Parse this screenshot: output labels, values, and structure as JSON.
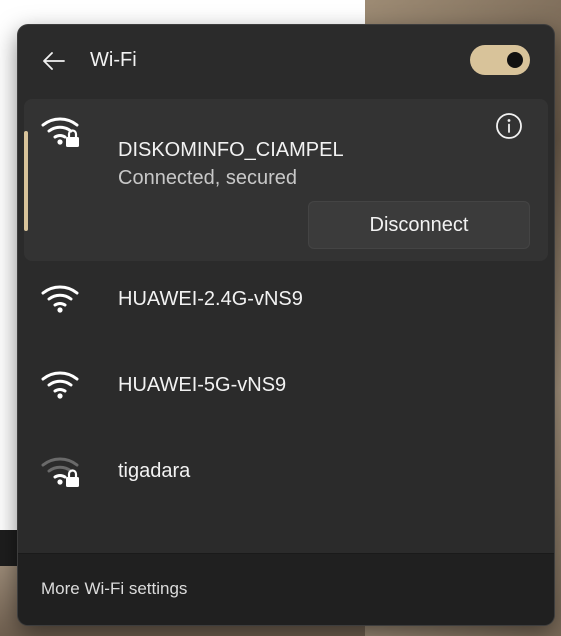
{
  "header": {
    "title": "Wi-Fi",
    "back_icon": "back-arrow-icon",
    "wifi_toggle_on": true,
    "accent_color": "#d8c39a"
  },
  "networks": [
    {
      "name": "DISKOMINFO_CIAMPEL",
      "status": "Connected, secured",
      "secured": true,
      "signal": "full",
      "icon": "wifi-secured-icon"
    },
    {
      "name": "HUAWEI-2.4G-vNS9",
      "secured": false,
      "signal": "full",
      "icon": "wifi-icon"
    },
    {
      "name": "HUAWEI-5G-vNS9",
      "secured": false,
      "signal": "full",
      "icon": "wifi-icon"
    },
    {
      "name": "tigadara",
      "secured": true,
      "signal": "weak",
      "icon": "wifi-weak-secured-icon"
    }
  ],
  "actions": {
    "disconnect_label": "Disconnect",
    "info_icon": "info-icon"
  },
  "footer": {
    "more_settings_label": "More Wi-Fi settings"
  }
}
